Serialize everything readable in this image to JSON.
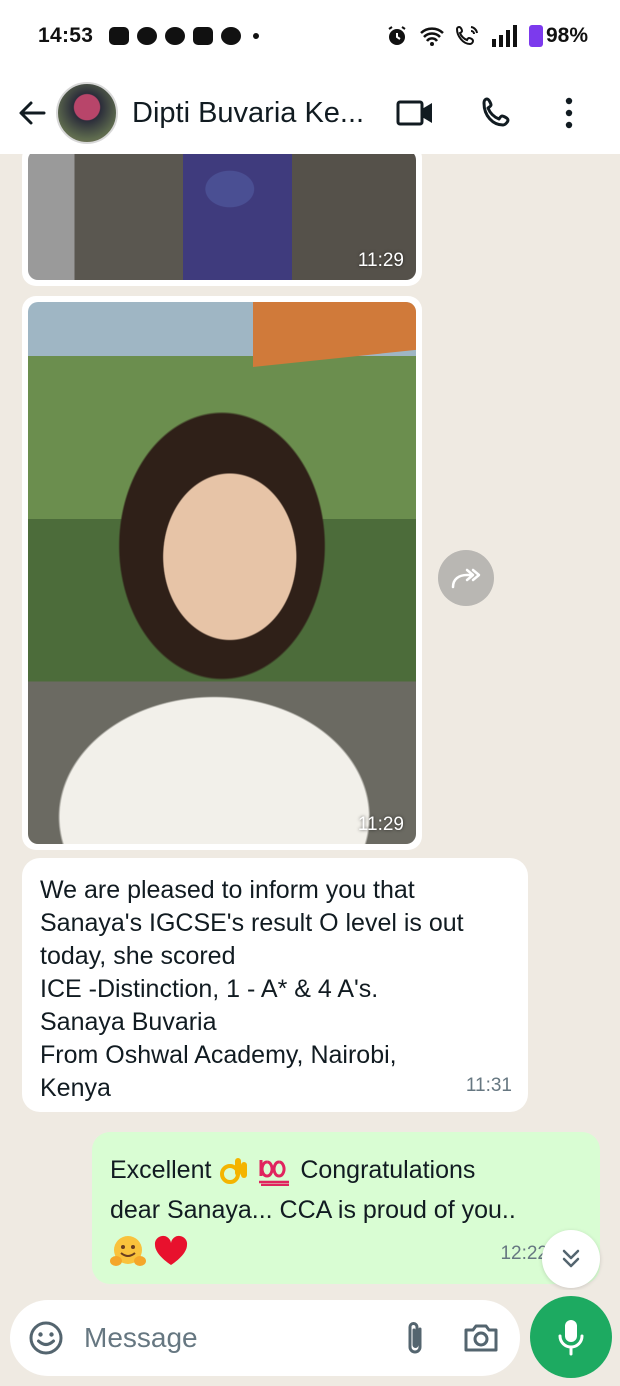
{
  "status_bar": {
    "time": "14:53",
    "battery": "98%"
  },
  "header": {
    "contact_name": "Dipti Buvaria Ke..."
  },
  "messages": {
    "image1_time": "11:29",
    "image2_time": "11:29",
    "incoming": {
      "lines": [
        "We are pleased to inform you that",
        "Sanaya's IGCSE's result O level is out",
        "today, she scored",
        "ICE -Distinction, 1 - A* & 4 A's.",
        "Sanaya Buvaria",
        "From Oshwal Academy, Nairobi,",
        "Kenya"
      ],
      "time": "11:31"
    },
    "outgoing": {
      "line1_a": "Excellent",
      "line1_b": "Congratulations",
      "line2": "dear Sanaya... CCA is proud of you..",
      "time": "12:22"
    }
  },
  "composer": {
    "placeholder": "Message"
  },
  "colors": {
    "chat_bg": "#efeae2",
    "outgoing_bubble": "#d9fdd3",
    "incoming_bubble": "#ffffff",
    "accent_green": "#1daa61"
  }
}
